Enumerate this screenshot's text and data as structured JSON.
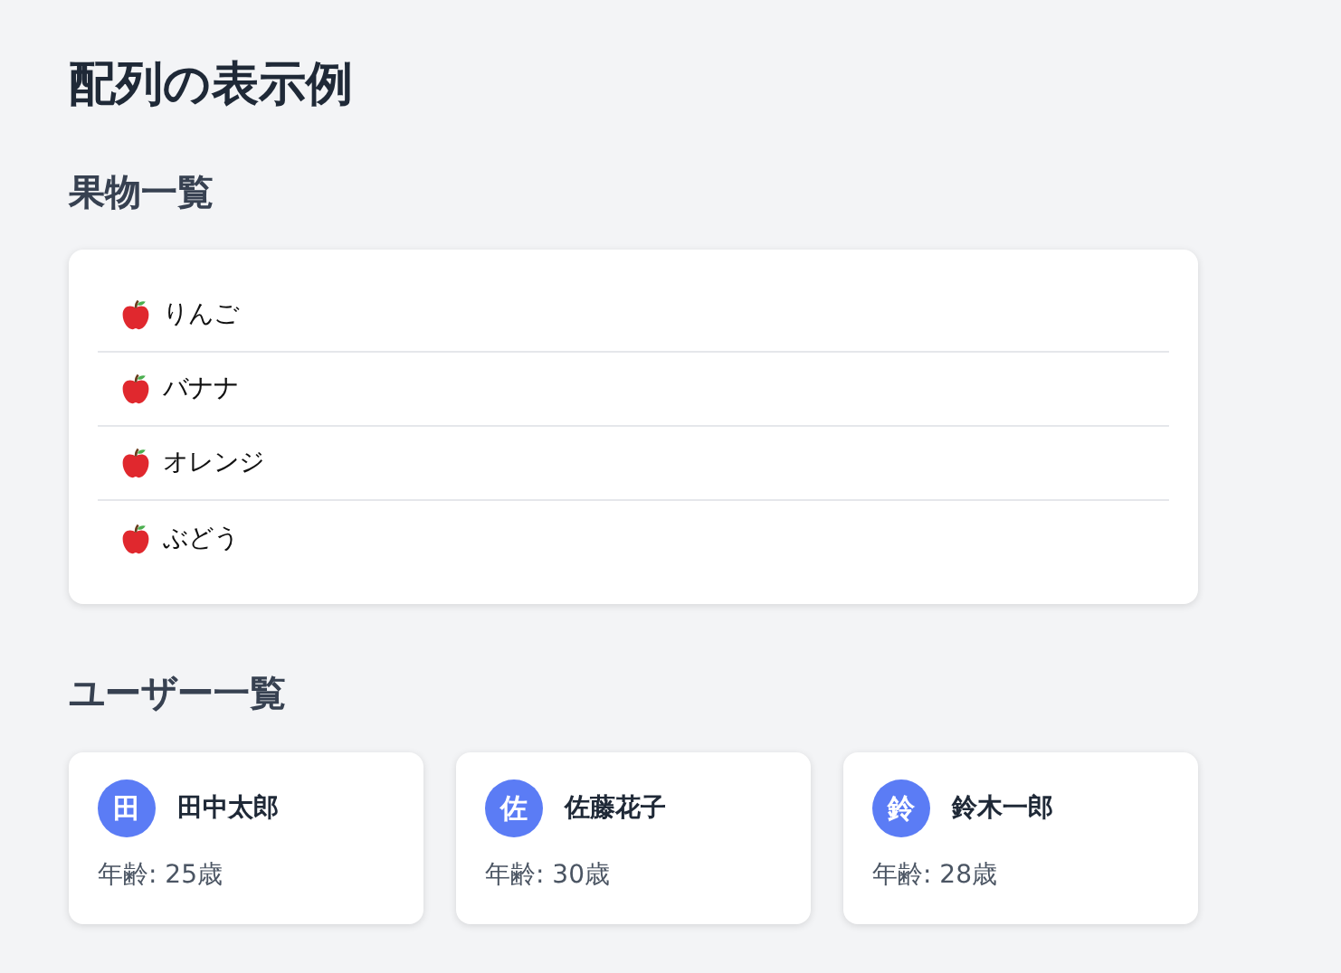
{
  "title": "配列の表示例",
  "fruits": {
    "heading": "果物一覧",
    "items": [
      {
        "label": "りんご"
      },
      {
        "label": "バナナ"
      },
      {
        "label": "オレンジ"
      },
      {
        "label": "ぶどう"
      }
    ]
  },
  "users": {
    "heading": "ユーザー一覧",
    "items": [
      {
        "initial": "田",
        "name": "田中太郎",
        "age": "年齢: 25歳"
      },
      {
        "initial": "佐",
        "name": "佐藤花子",
        "age": "年齢: 30歳"
      },
      {
        "initial": "鈴",
        "name": "鈴木一郎",
        "age": "年齢: 28歳"
      }
    ]
  }
}
